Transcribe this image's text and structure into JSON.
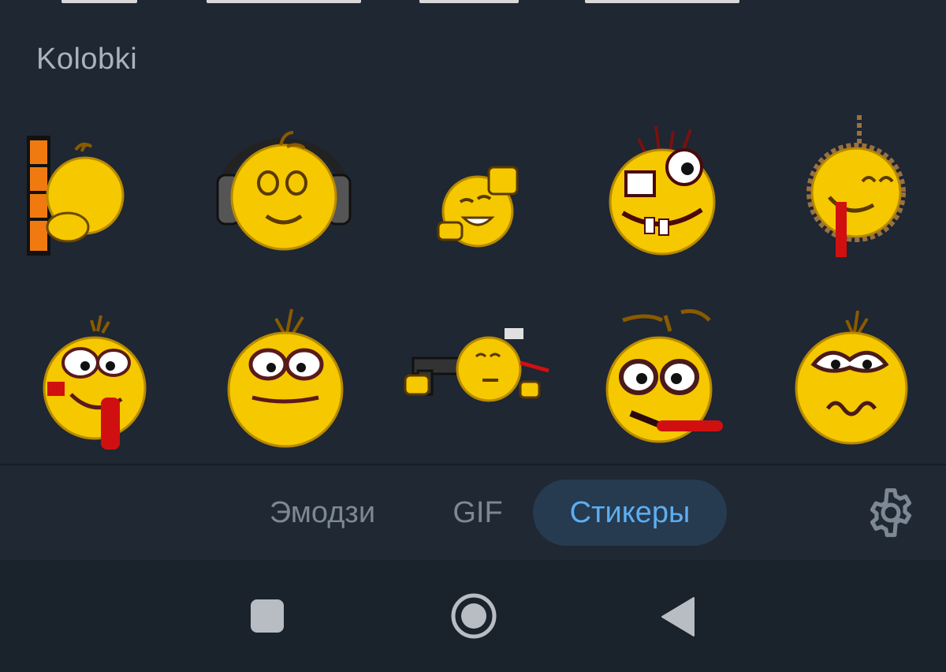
{
  "pack": {
    "title": "Kolobki"
  },
  "stickers": [
    {
      "id": "peek-behind-wall"
    },
    {
      "id": "headphones"
    },
    {
      "id": "laughing-fist"
    },
    {
      "id": "crazy-glasses"
    },
    {
      "id": "hanging-noose"
    },
    {
      "id": "tongue-out-red"
    },
    {
      "id": "wide-eyes-grin"
    },
    {
      "id": "gun-to-head"
    },
    {
      "id": "tongue-drool"
    },
    {
      "id": "worried-squiggle"
    }
  ],
  "tabs": [
    {
      "label": "Эмодзи",
      "active": false
    },
    {
      "label": "GIF",
      "active": false
    },
    {
      "label": "Стикеры",
      "active": true
    }
  ],
  "icons": {
    "settings": "gear-icon",
    "nav_recents": "square-icon",
    "nav_home": "circle-icon",
    "nav_back": "triangle-back-icon"
  },
  "colors": {
    "background": "#1e2732",
    "title": "#aab3bd",
    "tab_inactive": "#7c8894",
    "tab_active_text": "#5daef0",
    "tab_active_bg": "#263a50",
    "sticker_face": "#f5c800"
  }
}
